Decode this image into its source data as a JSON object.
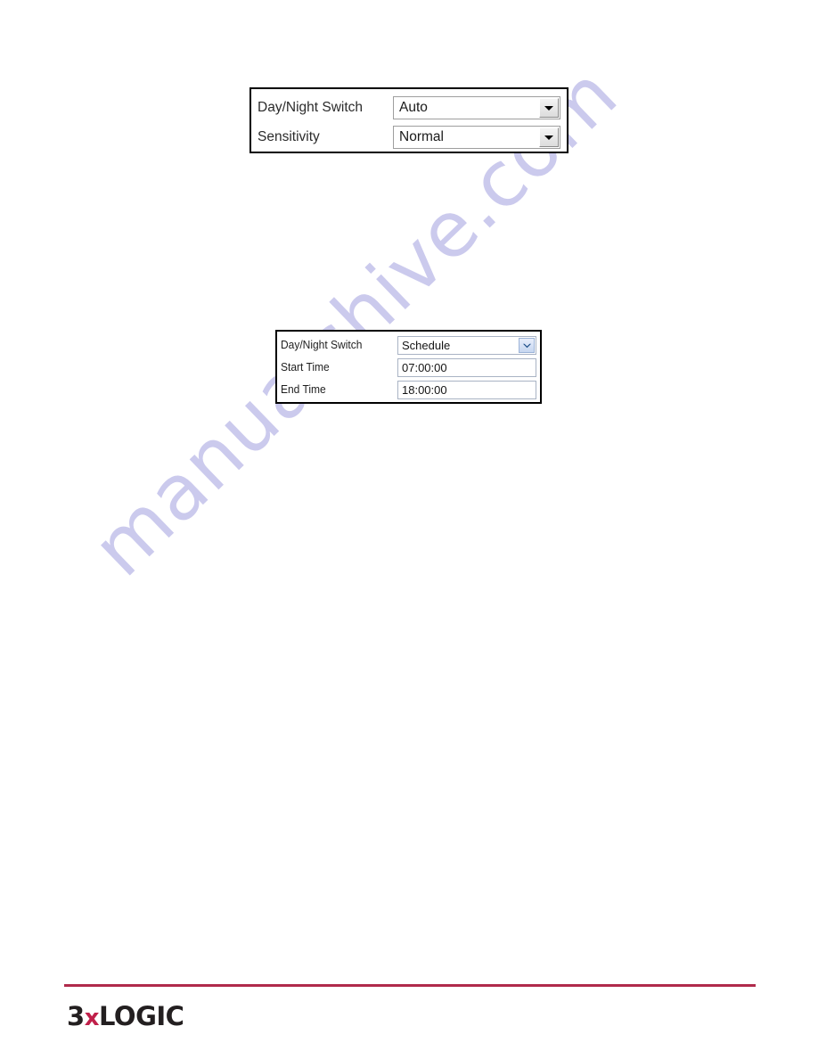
{
  "document": {
    "watermark": "manualshive.com",
    "background_color": "#ffffff"
  },
  "panels": [
    {
      "id": "day-night-auto",
      "rows": [
        {
          "label": "Day/Night Switch",
          "control": "dropdown",
          "value": "Auto",
          "icon": "chevron-down-icon"
        },
        {
          "label": "Sensitivity",
          "control": "dropdown",
          "value": "Normal",
          "icon": "chevron-down-icon"
        }
      ]
    },
    {
      "id": "day-night-schedule",
      "rows": [
        {
          "label": "Day/Night Switch",
          "control": "dropdown",
          "value": "Schedule",
          "icon": "chevron-down-icon"
        },
        {
          "label": "Start Time",
          "control": "textfield",
          "value": "07:00:00"
        },
        {
          "label": "End Time",
          "control": "textfield",
          "value": "18:00:00"
        }
      ]
    }
  ],
  "footer": {
    "rule_color": "#b02a4b",
    "brand": {
      "prefix": "3",
      "x": "x",
      "suffix": "LOGIC"
    }
  }
}
